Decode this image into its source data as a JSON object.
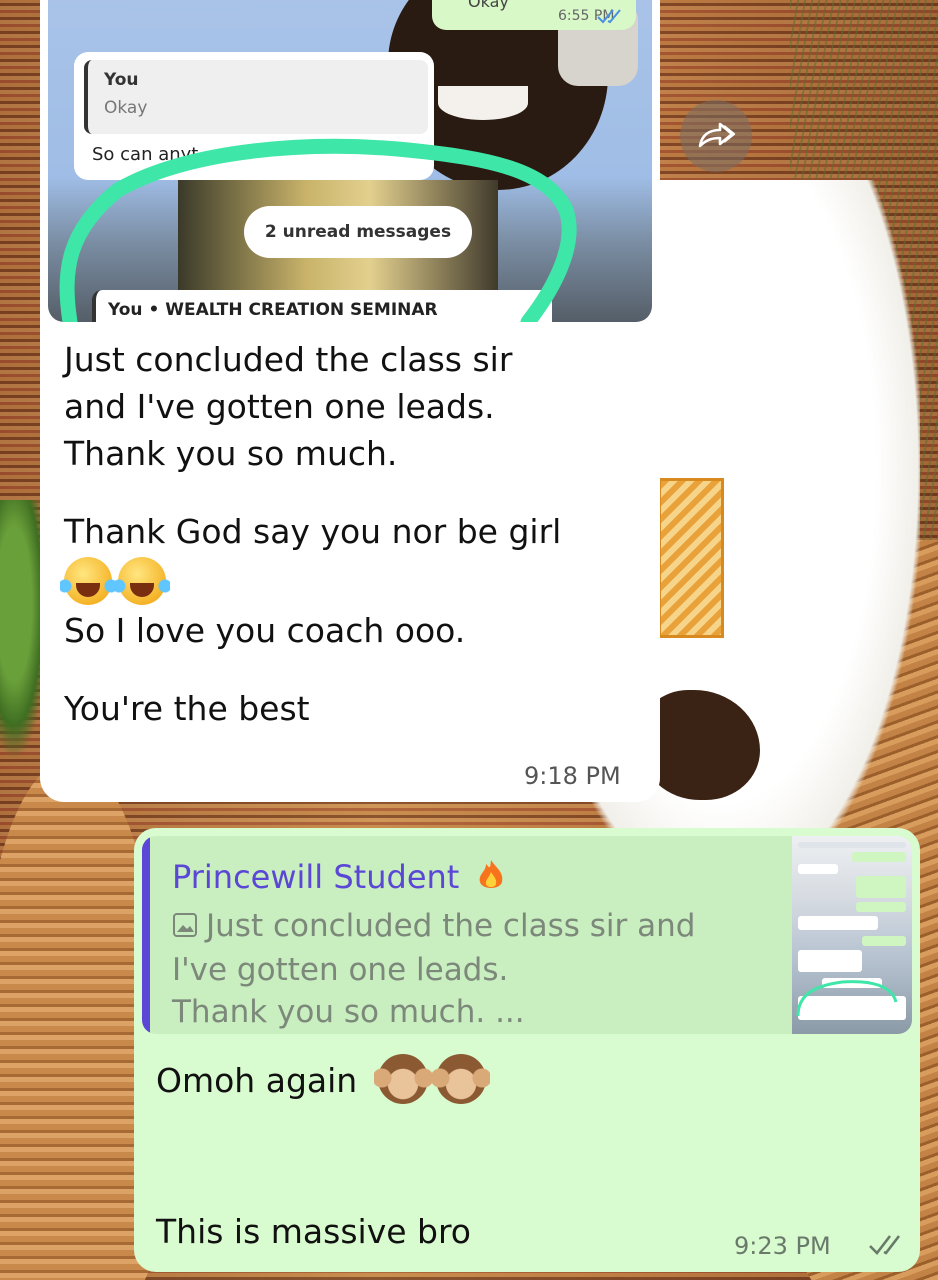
{
  "screenshot_image": {
    "outgoing_bubble_text": "Okay",
    "outgoing_bubble_time": "6:55 PM",
    "quoted_sender": "You",
    "quoted_text": "Okay",
    "message_text": "So can anyt",
    "unread_banner": "2 unread messages",
    "reply_sender": "You",
    "reply_context": "WEALTH CREATION SEMINAR"
  },
  "incoming_message": {
    "lines": [
      "Just concluded the class sir",
      "and I've gotten one leads.",
      "Thank you so much.",
      "Thank God say you nor be girl",
      "So I love you coach ooo.",
      "You're the best"
    ],
    "emojis": [
      "face-with-tears-of-joy",
      "face-with-tears-of-joy"
    ],
    "time": "9:18 PM"
  },
  "outgoing_message": {
    "quoted": {
      "sender": "Princewill Student",
      "sender_emoji": "fire",
      "preview_lines": [
        "Just concluded the class sir and",
        "I've gotten one leads.",
        "Thank you so much. ..."
      ],
      "preview_icon": "image-icon"
    },
    "text_line_1": "Omoh again",
    "text_emojis": [
      "hear-no-evil-monkey",
      "hear-no-evil-monkey"
    ],
    "text_line_2": "This is massive bro",
    "time": "9:23 PM",
    "status": "delivered-double-tick"
  },
  "colors": {
    "incoming_bubble": "#ffffff",
    "outgoing_bubble": "#d9fbd0",
    "quote_bar": "#5b47d6",
    "read_ticks": "#4a90e2"
  }
}
